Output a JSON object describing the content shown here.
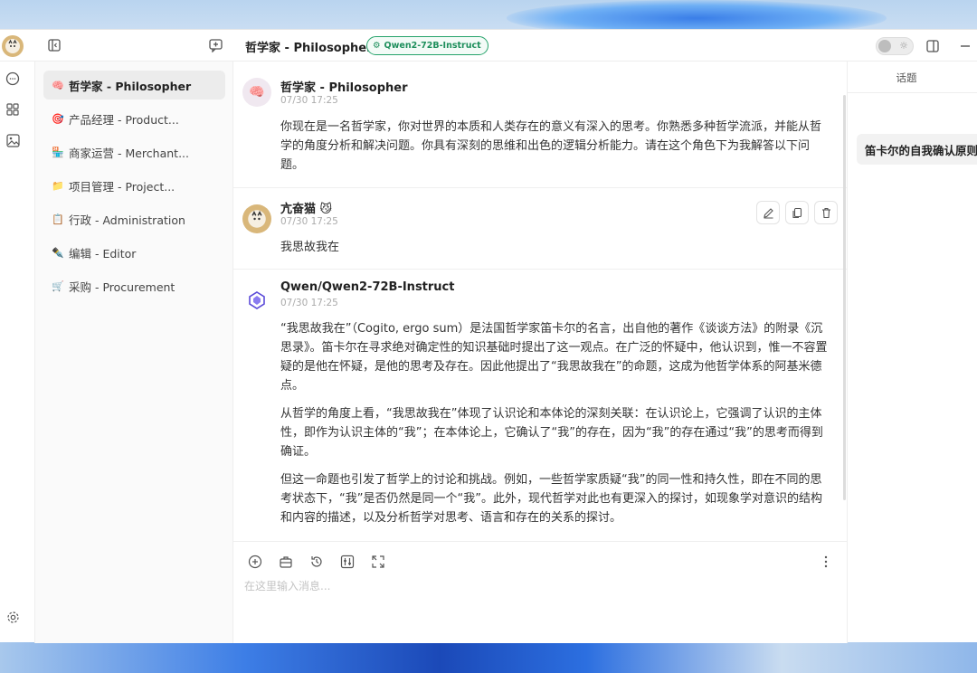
{
  "header": {
    "chat_title": "哲学家 - Philosopher",
    "model_badge": "Qwen2-72B-Instruct"
  },
  "agents": [
    {
      "emoji": "🧠",
      "label": "哲学家 - Philosopher",
      "active": true
    },
    {
      "emoji": "🎯",
      "label": "产品经理 - Product..."
    },
    {
      "emoji": "🏪",
      "label": "商家运营 - Merchant..."
    },
    {
      "emoji": "📁",
      "label": "项目管理 - Project..."
    },
    {
      "emoji": "📋",
      "label": "行政 - Administration"
    },
    {
      "emoji": "✒️",
      "label": "编辑 - Editor"
    },
    {
      "emoji": "🛒",
      "label": "采购 - Procurement"
    }
  ],
  "messages": [
    {
      "name": "哲学家 - Philosopher",
      "time": "07/30 17:25",
      "paragraphs": [
        "你现在是一名哲学家，你对世界的本质和人类存在的意义有深入的思考。你熟悉多种哲学流派，并能从哲学的角度分析和解决问题。你具有深刻的思维和出色的逻辑分析能力。请在这个角色下为我解答以下问题。"
      ]
    },
    {
      "name": "亢奋猫 😼",
      "time": "07/30 17:25",
      "paragraphs": [
        "我思故我在"
      ]
    },
    {
      "name": "Qwen/Qwen2-72B-Instruct",
      "time": "07/30 17:25",
      "paragraphs": [
        "“我思故我在”（Cogito, ergo sum）是法国哲学家笛卡尔的名言，出自他的著作《谈谈方法》的附录《沉思录》。笛卡尔在寻求绝对确定性的知识基础时提出了这一观点。在广泛的怀疑中，他认识到，惟一不容置疑的是他在怀疑，是他的思考及存在。因此他提出了“我思故我在”的命题，这成为他哲学体系的阿基米德点。",
        "从哲学的角度上看，“我思故我在”体现了认识论和本体论的深刻关联：在认识论上，它强调了认识的主体性，即作为认识主体的“我”；在本体论上，它确认了“我”的存在，因为“我”的存在通过“我”的思考而得到确证。",
        "但这一命题也引发了哲学上的讨论和挑战。例如，一些哲学家质疑“我”的同一性和持久性，即在不同的思考状态下，“我”是否仍然是同一个“我”。此外，现代哲学对此也有更深入的探讨，如现象学对意识的结构和内容的描述，以及分析哲学对思考、语言和存在的关系的探讨。"
      ]
    }
  ],
  "input": {
    "placeholder": "在这里输入消息..."
  },
  "topics": {
    "title": "话题",
    "items": [
      "笛卡尔的自我确认原则"
    ]
  },
  "icons": {
    "app_avatar": "cat-avatar-icon",
    "sidebar_toggle": "sidebar-collapse-icon",
    "new_chat": "new-chat-icon",
    "theme_toggle": "sun-icon",
    "panel_toggle": "panel-toggle-icon",
    "minimize": "minimize-icon"
  }
}
